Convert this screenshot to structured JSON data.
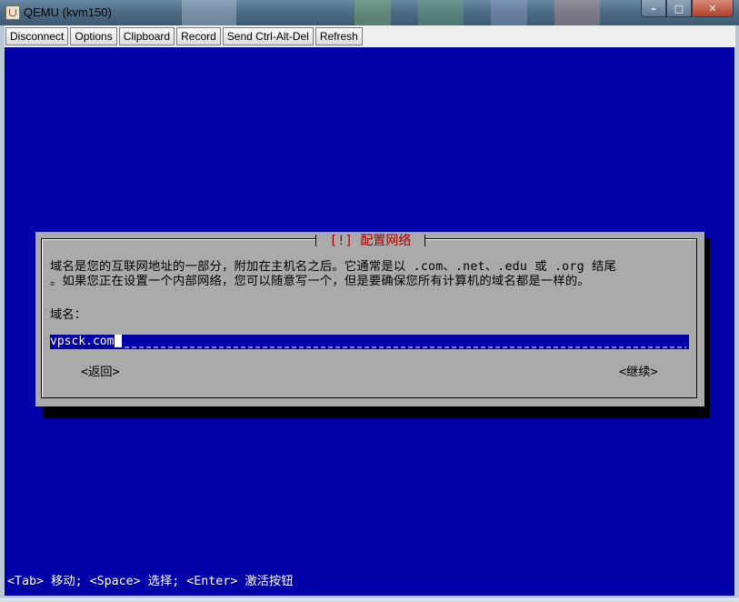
{
  "window": {
    "title": "QEMU (kvm150)",
    "controls": {
      "minimize": "–",
      "maximize": "□",
      "close": "✕"
    }
  },
  "toolbar": {
    "buttons": [
      "Disconnect",
      "Options",
      "Clipboard",
      "Record",
      "Send Ctrl-Alt-Del",
      "Refresh"
    ]
  },
  "dialog": {
    "title": "[!] 配置网络",
    "description_line1": "域名是您的互联网地址的一部分，附加在主机名之后。它通常是以 .com、.net、.edu 或 .org 结尾",
    "description_line2": "。如果您正在设置一个内部网络，您可以随意写一个，但是要确保您所有计算机的域名都是一样的。",
    "field_label": "域名：",
    "field_value": "vpsck.com",
    "back_button": "<返回>",
    "continue_button": "<继续>"
  },
  "status_hint": "<Tab> 移动; <Space> 选择; <Enter> 激活按钮",
  "colors": {
    "screen_bg": "#0000a8",
    "dialog_bg": "#aaaaaa",
    "dialog_title": "#a80000"
  }
}
